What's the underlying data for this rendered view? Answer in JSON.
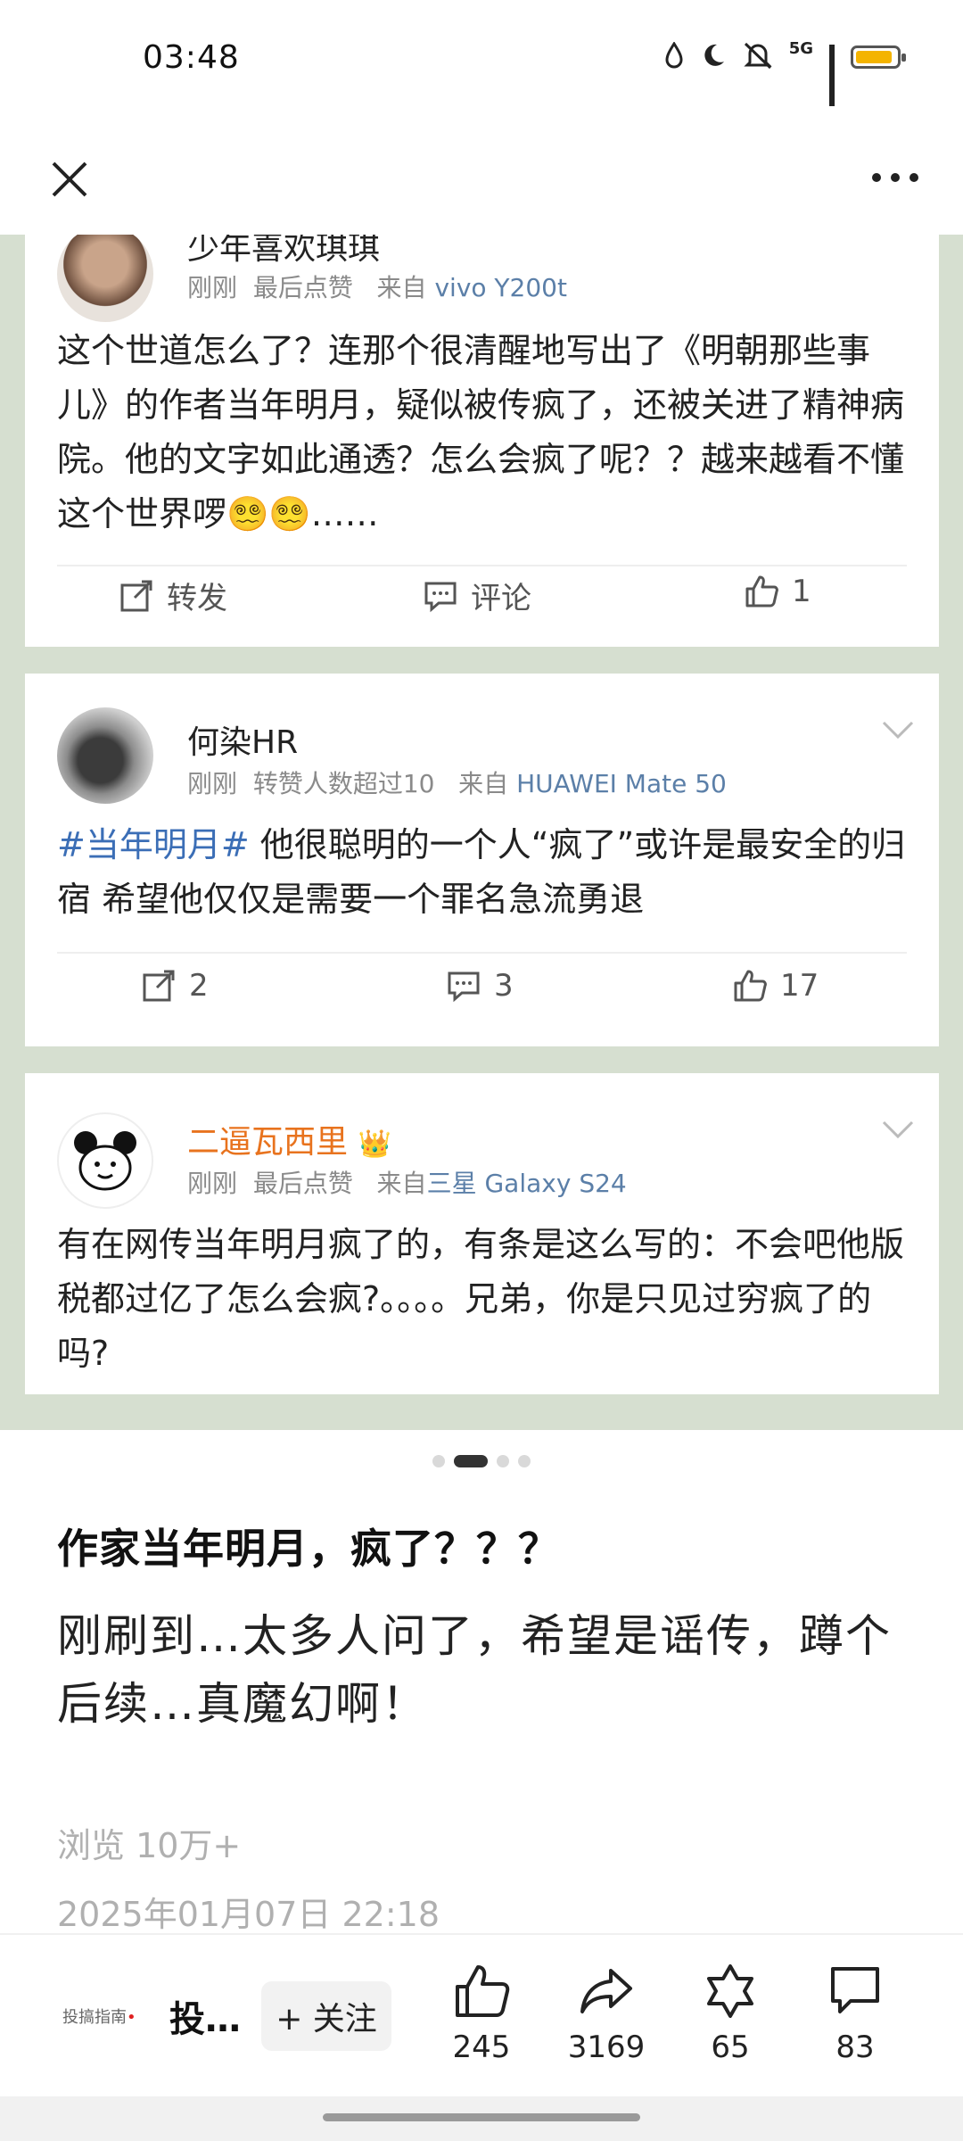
{
  "status_bar": {
    "time": "03:48",
    "network": "5G",
    "battery_level": 0.9
  },
  "nav": {
    "close_icon": "close-icon",
    "more_icon": "more-icon"
  },
  "screenshot": {
    "cards": [
      {
        "username": "少年喜欢琪琪",
        "time": "刚刚",
        "activity": "最后点赞",
        "source_prefix": "来自",
        "device": "vivo Y200t",
        "text": "这个世道怎么了？连那个很清醒地写出了《明朝那些事儿》的作者当年明月，疑似被传疯了，还被关进了精神病院。他的文字如此通透？怎么会疯了呢？？越来越看不懂这个世界啰😵‍💫😵‍💫……",
        "repost_label": "转发",
        "comment_label": "评论",
        "likes": "1"
      },
      {
        "username": "何染HR",
        "time": "刚刚",
        "activity": "转赞人数超过10",
        "source_prefix": "来自",
        "device": "HUAWEI Mate 50",
        "hashtag": "#当年明月#",
        "text": " 他很聪明的一个人“疯了”或许是最安全的归宿  希望他仅仅是需要一个罪名急流勇退",
        "reposts": "2",
        "comments": "3",
        "likes": "17"
      },
      {
        "username": "二逼瓦西里",
        "crown": "👑",
        "time": "刚刚",
        "activity": "最后点赞",
        "source_prefix": "来自",
        "device_prefix": "三星",
        "device": "Galaxy S24",
        "text": "有在网传当年明月疯了的，有条是这么写的：不会吧他版税都过亿了怎么会疯?。。。。兄弟，你是只见过穷疯了的吗?"
      }
    ]
  },
  "pager": {
    "total": 4,
    "active": 1
  },
  "post": {
    "title": "作家当年明月，疯了？？？",
    "body": "刚刷到…太多人问了，希望是谣传，蹲个后续…真魔幻啊！",
    "views": "浏览 10万+",
    "date": "2025年01月07日 22:18"
  },
  "bottom_bar": {
    "brand_logo_text": "投搞指南",
    "brand_name": "投…",
    "follow_label": "+ 关注",
    "likes": "245",
    "shares": "3169",
    "favorites": "65",
    "comments": "83"
  }
}
